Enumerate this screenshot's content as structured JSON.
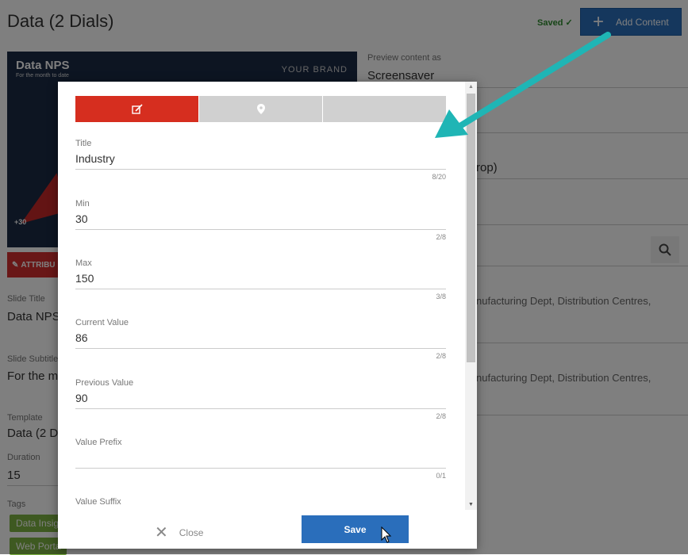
{
  "page": {
    "title": "Data (2 Dials)",
    "saved": "Saved ✓",
    "add_content": "Add Content"
  },
  "thumbnail": {
    "title": "Data NPS",
    "subtitle": "For the month to date",
    "brand": "YOUR BRAND",
    "value": "+30"
  },
  "attributes_label": "ATTRIBU",
  "left_fields": {
    "slide_title_label": "Slide Title",
    "slide_title_value": "Data NPS",
    "slide_subtitle_label": "Slide Subtitle",
    "slide_subtitle_value": "For the m",
    "template_label": "Template",
    "template_value": "Data (2 Di",
    "duration_label": "Duration",
    "duration_value": "15",
    "tags_label": "Tags",
    "tags": [
      "Data Insig",
      "Web Porta"
    ]
  },
  "right_panel": {
    "preview_label": "Preview content as",
    "preview_value": "Screensaver",
    "crop_text": "rop)",
    "row1": "nufacturing Dept, Distribution Centres,",
    "row2": "nufacturing Dept, Distribution Centres,"
  },
  "modal": {
    "fields": [
      {
        "label": "Title",
        "value": "Industry",
        "count": "8/20"
      },
      {
        "label": "Min",
        "value": "30",
        "count": "2/8"
      },
      {
        "label": "Max",
        "value": "150",
        "count": "3/8"
      },
      {
        "label": "Current Value",
        "value": "86",
        "count": "2/8"
      },
      {
        "label": "Previous Value",
        "value": "90",
        "count": "2/8"
      },
      {
        "label": "Value Prefix",
        "value": "",
        "count": "0/1"
      },
      {
        "label": "Value Suffix",
        "value": "",
        "count": ""
      }
    ],
    "close_label": "Close",
    "save_label": "Save"
  },
  "colors": {
    "primary": "#2a6ebb",
    "active_tab": "#d62e1f",
    "tag": "#7cb342",
    "arrow": "#1fb5b5"
  }
}
